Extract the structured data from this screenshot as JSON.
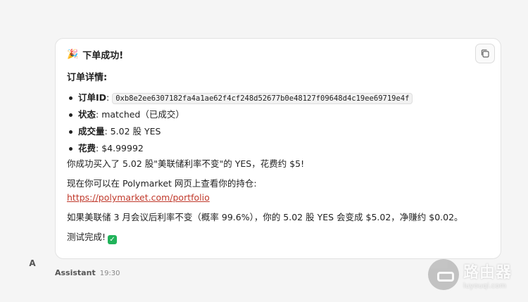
{
  "message": {
    "title_emoji": "🎉",
    "title": "下单成功!",
    "details_heading": "订单详情:",
    "details": [
      {
        "key": "订单ID",
        "sep": ": ",
        "value": "0xb8e2ee6307182fa4a1ae62f4cf248d52677b0e48127f09648d4c19ee69719e4f"
      },
      {
        "key": "状态",
        "sep": ": ",
        "value": "matched（已成交）"
      },
      {
        "key": "成交量",
        "sep": ": ",
        "value": "5.02 股 YES"
      },
      {
        "key": "花费",
        "sep": ": ",
        "value": "$4.99992"
      }
    ],
    "summary": "你成功买入了 5.02 股\"美联储利率不变\"的 YES，花费约 $5!",
    "portfolio_text": "现在你可以在 Polymarket 网页上查看你的持仓:",
    "portfolio_link": "https://polymarket.com/portfolio",
    "outcome": "如果美联储 3 月会议后利率不变（概率 99.6%），你的 5.02 股 YES 会变成 $5.02，净赚约 $0.02。",
    "done": "测试完成!",
    "done_check": "✓"
  },
  "sender": {
    "avatar": "A",
    "name": "Assistant",
    "time": "19:30"
  },
  "watermark": {
    "main": "路由器",
    "sub": "luyouqi.com"
  },
  "icons": {
    "copy": "copy-icon"
  }
}
